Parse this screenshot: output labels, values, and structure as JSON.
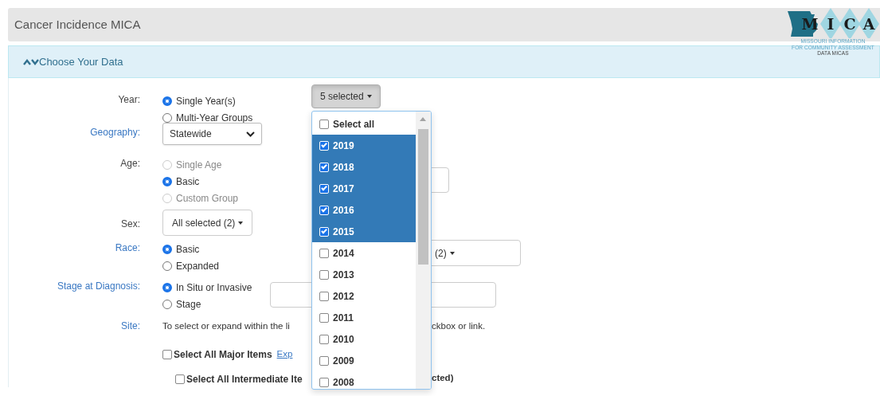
{
  "header": {
    "title": "Cancer Incidence MICA",
    "logo": {
      "letters": [
        "M",
        "I",
        "C",
        "A"
      ],
      "tagline": [
        "MISSOURI INFORMATION",
        "FOR COMMUNITY ASSESSMENT",
        "DATA MICAS"
      ]
    }
  },
  "panel": {
    "title": "Choose Your Data",
    "expanded": true
  },
  "fields": [
    {
      "label": "Year:",
      "link": false,
      "kind": "radios",
      "options": [
        {
          "label": "Single Year(s)",
          "selected": true,
          "disabled": false
        },
        {
          "label": "Multi-Year Groups",
          "selected": false,
          "disabled": false
        }
      ],
      "side": {
        "kind": "multiselect",
        "text": "5 selected",
        "expanded": true,
        "items": [
          {
            "label": "Select all",
            "checked": false
          },
          {
            "label": "2019",
            "checked": true
          },
          {
            "label": "2018",
            "checked": true
          },
          {
            "label": "2017",
            "checked": true
          },
          {
            "label": "2016",
            "checked": true
          },
          {
            "label": "2015",
            "checked": true
          },
          {
            "label": "2014",
            "checked": false
          },
          {
            "label": "2013",
            "checked": false
          },
          {
            "label": "2012",
            "checked": false
          },
          {
            "label": "2011",
            "checked": false
          },
          {
            "label": "2010",
            "checked": false
          },
          {
            "label": "2009",
            "checked": false
          },
          {
            "label": "2008",
            "checked": false
          }
        ]
      }
    },
    {
      "label": "Geography:",
      "link": true,
      "kind": "select",
      "value": "Statewide"
    },
    {
      "label": "Age:",
      "link": false,
      "kind": "radios",
      "options": [
        {
          "label": "Single Age",
          "selected": false,
          "disabled": true
        },
        {
          "label": "Basic",
          "selected": true,
          "disabled": false
        },
        {
          "label": "Custom Group",
          "selected": false,
          "disabled": true
        }
      ],
      "side": {
        "kind": "field"
      }
    },
    {
      "label": "Sex:",
      "link": false,
      "kind": "dropdown",
      "text": "All selected (2)"
    },
    {
      "label": "Race:",
      "link": true,
      "kind": "radios",
      "options": [
        {
          "label": "Basic",
          "selected": true,
          "disabled": false
        },
        {
          "label": "Expanded",
          "selected": false,
          "disabled": false
        }
      ],
      "side": {
        "kind": "dropdown",
        "text": "(2)"
      }
    },
    {
      "label": "Stage at Diagnosis:",
      "link": true,
      "kind": "radios",
      "options": [
        {
          "label": "In Situ or Invasive",
          "selected": true,
          "disabled": false
        },
        {
          "label": "Stage",
          "selected": false,
          "disabled": false
        }
      ],
      "side": {
        "kind": "wide-field"
      }
    },
    {
      "label": "Site:",
      "link": true,
      "kind": "site",
      "intro": [
        "To select or expand within the li",
        "ckbox or link."
      ],
      "checks": [
        {
          "label": "Select All Major Items",
          "checked": false,
          "link": "Exp"
        },
        {
          "label": "Select All Intermediate Ite",
          "checked": false,
          "tail": "cted)"
        }
      ]
    }
  ]
}
